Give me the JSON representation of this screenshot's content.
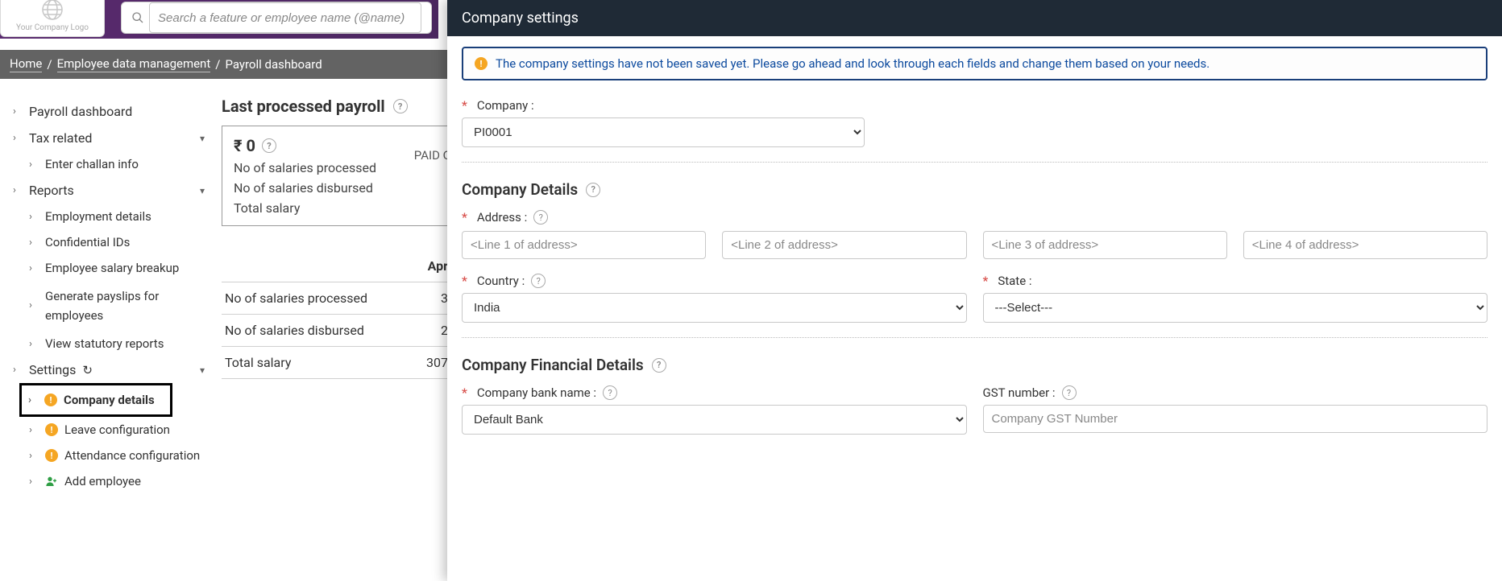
{
  "logo": {
    "text": "Your Company Logo"
  },
  "search": {
    "placeholder": "Search a feature or employee name (@name)"
  },
  "breadcrumbs": {
    "home": "Home",
    "l1": "Employee data management",
    "l2": "Payroll dashboard"
  },
  "sidebar": {
    "payroll_dashboard": "Payroll dashboard",
    "tax_related": "Tax related",
    "enter_challan": "Enter challan info",
    "reports": "Reports",
    "emp_details": "Employment details",
    "confidential_ids": "Confidential IDs",
    "salary_breakup": "Employee salary breakup",
    "gen_payslips": "Generate payslips for employees",
    "view_stat": "View statutory reports",
    "settings": "Settings",
    "company_details": "Company details",
    "leave_config": "Leave configuration",
    "attendance_config": "Attendance configuration",
    "add_employee": "Add employee"
  },
  "center": {
    "title": "Last processed payroll",
    "amount": "₹ 0",
    "line1": "No of salaries processed",
    "line2": "No of salaries disbursed",
    "line3": "Total salary",
    "paid_o": "PAID O",
    "month_col": "Apr",
    "rows": [
      {
        "label": "No of salaries processed",
        "val": "3"
      },
      {
        "label": "No of salaries disbursed",
        "val": "2"
      },
      {
        "label": "Total salary",
        "val": "307"
      }
    ]
  },
  "panel": {
    "title": "Company settings",
    "alert": "The company settings have not been saved yet. Please go ahead and look through each fields and change them based on your needs.",
    "company_label": "Company :",
    "company_value": "PI0001",
    "details_heading": "Company Details",
    "address_label": "Address :",
    "addr_ph": [
      "<Line 1 of address>",
      "<Line 2 of address>",
      "<Line 3 of address>",
      "<Line 4 of address>"
    ],
    "country_label": "Country :",
    "country_value": "India",
    "state_label": "State :",
    "state_value": "---Select---",
    "fin_heading": "Company Financial Details",
    "bank_label": "Company bank name :",
    "bank_value": "Default Bank",
    "gst_label": "GST number :",
    "gst_ph": "Company GST Number"
  }
}
